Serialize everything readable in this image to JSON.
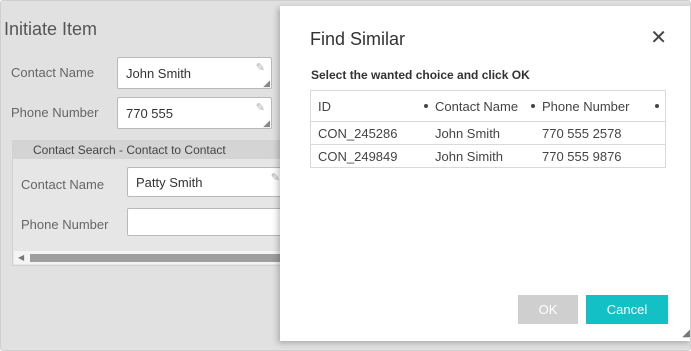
{
  "background_form": {
    "title": "Initiate Item",
    "contact_name_label": "Contact Name",
    "contact_name_value": "John Smith",
    "phone_number_label": "Phone Number",
    "phone_number_value": "770 555",
    "section": {
      "title": "Contact Search - Contact to Contact",
      "contact_name_label": "Contact Name",
      "contact_name_value": "Patty Smith",
      "phone_number_label": "Phone Number",
      "phone_number_value": ""
    }
  },
  "dialog": {
    "title": "Find Similar",
    "close_icon": "close-icon",
    "instruction": "Select the wanted choice and click OK",
    "columns": [
      "ID",
      "Contact Name",
      "Phone Number"
    ],
    "rows": [
      {
        "id": "CON_245286",
        "contact_name": "John Smith",
        "phone": "770 555 2578"
      },
      {
        "id": "CON_249849",
        "contact_name": "John Simith",
        "phone": "770 555 9876"
      }
    ],
    "ok_label": "OK",
    "cancel_label": "Cancel",
    "colors": {
      "accent": "#12c0c5",
      "disabled": "#cfcfcf"
    }
  }
}
